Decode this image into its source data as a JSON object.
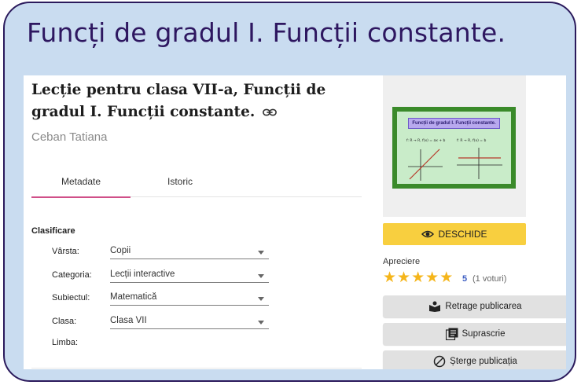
{
  "banner": {
    "title": "Funcți de gradul I. Funcții constante."
  },
  "lesson": {
    "title": "Lecție pentru clasa VII-a, Funcții de gradul I. Funcții constante.",
    "author": "Ceban Tatiana"
  },
  "tabs": [
    {
      "label": "Metadate",
      "active": true
    },
    {
      "label": "Istoric",
      "active": false
    }
  ],
  "classification": {
    "heading": "Clasificare",
    "fields": [
      {
        "label": "Vârsta:",
        "value": "Copii"
      },
      {
        "label": "Categoria:",
        "value": "Lecții interactive"
      },
      {
        "label": "Subiectul:",
        "value": "Matematică"
      },
      {
        "label": "Clasa:",
        "value": "Clasa VII"
      },
      {
        "label": "Limba:",
        "value": ""
      }
    ]
  },
  "thumbnail": {
    "title": "Funcții de gradul I. Funcții constante.",
    "left_formula": "f: R → R, f(x) = ax + b",
    "right_formula": "f: R → R, f(x) = b"
  },
  "open_button": {
    "label": "DESCHIDE",
    "icon": "eye-icon"
  },
  "rating": {
    "label": "Apreciere",
    "stars": 5,
    "score": "5",
    "votes": "(1 voturi)"
  },
  "actions": [
    {
      "label": "Retrage publicarea",
      "icon": "unpublish-icon"
    },
    {
      "label": "Suprascrie",
      "icon": "overwrite-icon"
    },
    {
      "label": "Șterge publicația",
      "icon": "block-icon"
    }
  ],
  "colors": {
    "frame_bg": "#c9dcf0",
    "banner_text": "#2e1760",
    "tab_accent": "#d04f88",
    "open_button": "#f8cf3f",
    "stars": "#f5b51a",
    "score": "#3e5fc3"
  }
}
